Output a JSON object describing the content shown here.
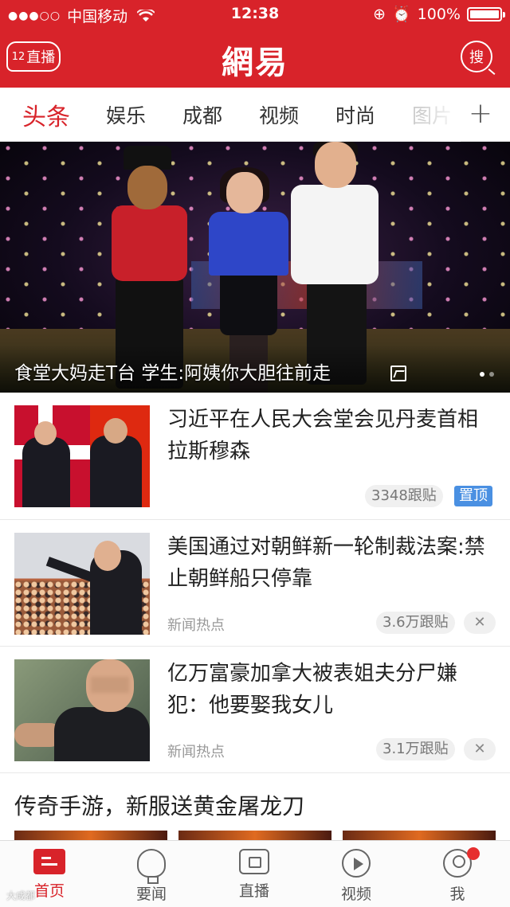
{
  "status_bar": {
    "signal": "●●●○○",
    "carrier": "中国移动",
    "time": "12:38",
    "battery": "100%"
  },
  "header": {
    "live_count": "12",
    "live_label": "直播",
    "logo": "網易",
    "search_label": "搜"
  },
  "tabs": [
    "头条",
    "娱乐",
    "成都",
    "视频",
    "时尚",
    "图片"
  ],
  "tabs_more": "+",
  "hero": {
    "title": "食堂大妈走T台 学生:阿姨你大胆往前走"
  },
  "news": [
    {
      "headline": "习近平在人民大会堂会见丹麦首相拉斯穆森",
      "source": "",
      "comments": "3348跟贴",
      "badge": "置顶"
    },
    {
      "headline": "美国通过对朝鲜新一轮制裁法案:禁止朝鲜船只停靠",
      "source": "新闻热点",
      "comments": "3.6万跟贴",
      "close": "✕"
    },
    {
      "headline": "亿万富豪加拿大被表姐夫分尸嫌犯：他要娶我女儿",
      "source": "新闻热点",
      "comments": "3.1万跟贴",
      "close": "✕"
    }
  ],
  "promo": {
    "title": "传奇手游，新服送黄金屠龙刀"
  },
  "bottom_nav": [
    {
      "label": "首页",
      "icon": "home-icon"
    },
    {
      "label": "要闻",
      "icon": "bulb-icon"
    },
    {
      "label": "直播",
      "icon": "live-icon"
    },
    {
      "label": "视频",
      "icon": "play-icon"
    },
    {
      "label": "我",
      "icon": "user-icon"
    }
  ],
  "watermark": "大成都",
  "colors": {
    "brand_red": "#d8232a",
    "pin_blue": "#4a90e2"
  }
}
